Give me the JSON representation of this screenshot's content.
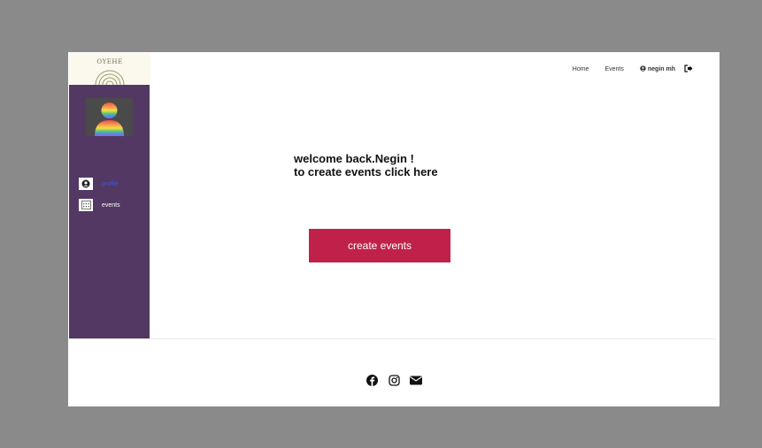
{
  "brand": {
    "logo_text": "OYEHE"
  },
  "nav": {
    "home": "Home",
    "events": "Events",
    "user": "negin mh"
  },
  "sidebar": {
    "items": [
      {
        "label": "profile",
        "icon": "user-circle-icon",
        "active": true
      },
      {
        "label": "events",
        "icon": "calendar-icon",
        "active": false
      }
    ]
  },
  "main": {
    "welcome_line1": "welcome back.Negin !",
    "welcome_line2": "to create events click here",
    "cta_label": "create events"
  },
  "colors": {
    "sidebar": "#533863",
    "accent": "#c0214a",
    "active_link": "#3d5ad6"
  }
}
